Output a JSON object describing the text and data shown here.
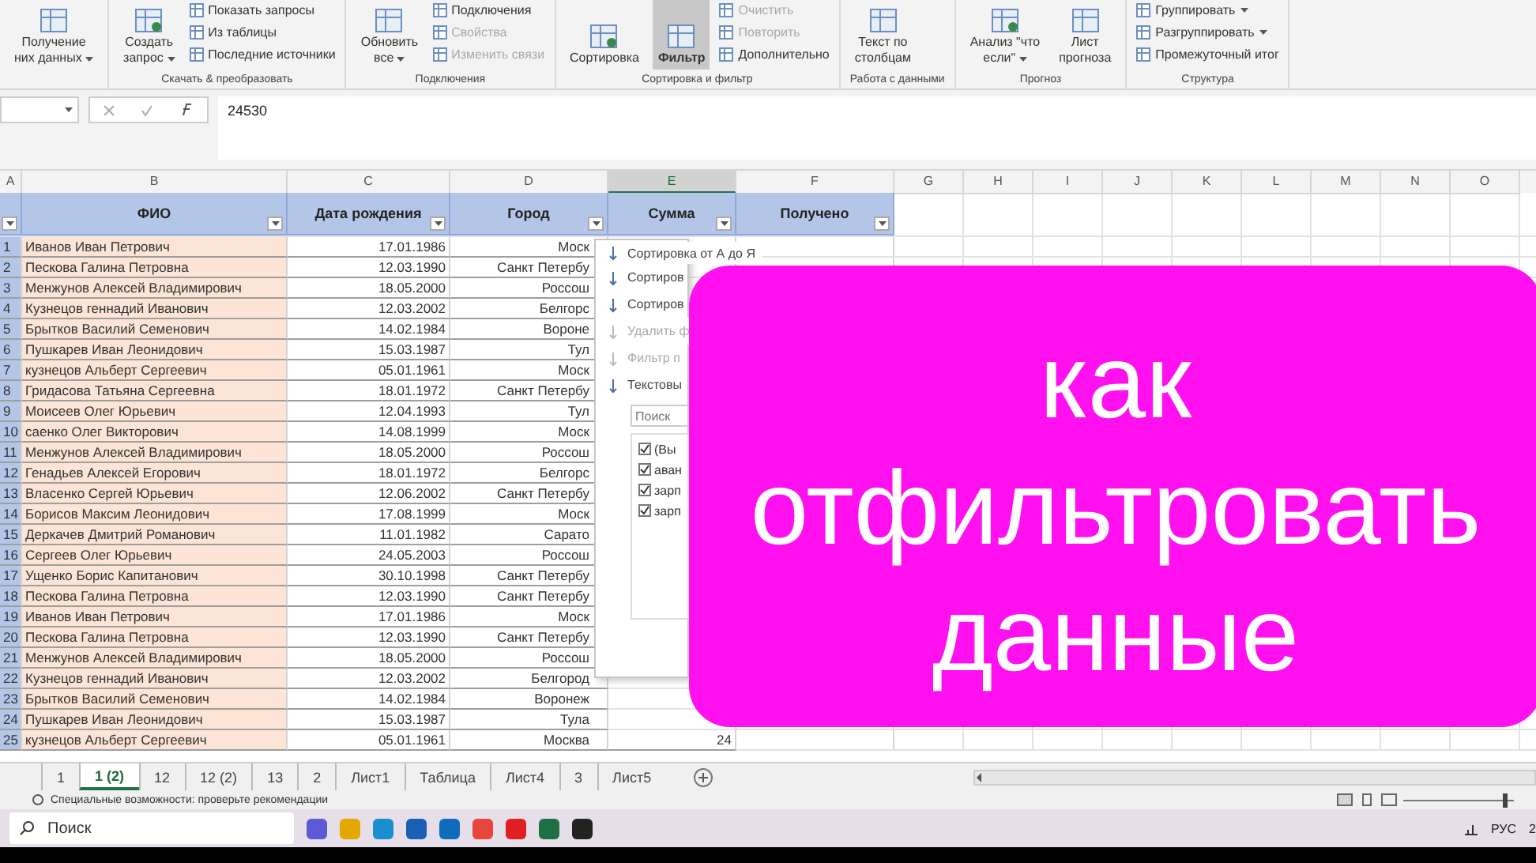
{
  "ribbon": {
    "groups": [
      {
        "items": [
          {
            "kind": "big",
            "lines": [
              "Получение",
              "них данных"
            ],
            "caret": true,
            "disabled": false,
            "selected": false
          }
        ]
      },
      {
        "label": "Скачать & преобразовать",
        "items": [
          {
            "kind": "big",
            "lines": [
              "Создать",
              "запрос"
            ],
            "caret": true,
            "disabled": false,
            "selected": false
          },
          {
            "kind": "small",
            "lines": [
              "Показать запросы"
            ],
            "caret": false,
            "disabled": false,
            "selected": false
          },
          {
            "kind": "small",
            "lines": [
              "Из таблицы"
            ],
            "caret": false,
            "disabled": false,
            "selected": false
          },
          {
            "kind": "small",
            "lines": [
              "Последние источники"
            ],
            "caret": false,
            "disabled": false,
            "selected": false
          }
        ]
      },
      {
        "label": "Подключения",
        "items": [
          {
            "kind": "big",
            "lines": [
              "Обновить",
              "все"
            ],
            "caret": true,
            "disabled": false,
            "selected": false
          },
          {
            "kind": "small",
            "lines": [
              "Подключения"
            ],
            "caret": false,
            "disabled": false,
            "selected": false
          },
          {
            "kind": "small",
            "lines": [
              "Свойства"
            ],
            "caret": false,
            "disabled": true,
            "selected": false
          },
          {
            "kind": "small",
            "lines": [
              "Изменить связи"
            ],
            "caret": false,
            "disabled": true,
            "selected": false
          }
        ]
      },
      {
        "label": "Сортировка и фильтр",
        "items": [
          {
            "kind": "big",
            "lines": [
              "Сортировка"
            ],
            "caret": false,
            "disabled": false,
            "selected": false
          },
          {
            "kind": "big",
            "lines": [
              "Фильтр"
            ],
            "caret": false,
            "disabled": false,
            "selected": true
          },
          {
            "kind": "small",
            "lines": [
              "Очистить"
            ],
            "caret": false,
            "disabled": true,
            "selected": false
          },
          {
            "kind": "small",
            "lines": [
              "Повторить"
            ],
            "caret": false,
            "disabled": true,
            "selected": false
          },
          {
            "kind": "small",
            "lines": [
              "Дополнительно"
            ],
            "caret": false,
            "disabled": false,
            "selected": false
          }
        ]
      },
      {
        "label": "Работа с данными",
        "items": [
          {
            "kind": "big",
            "lines": [
              "Текст по",
              "столбцам"
            ],
            "caret": false,
            "disabled": false,
            "selected": false
          }
        ]
      },
      {
        "label": "Прогноз",
        "items": [
          {
            "kind": "big",
            "lines": [
              "Анализ \"что",
              "если\""
            ],
            "caret": true,
            "disabled": false,
            "selected": false
          },
          {
            "kind": "big",
            "lines": [
              "Лист",
              "прогноза"
            ],
            "caret": false,
            "disabled": false,
            "selected": false
          }
        ]
      },
      {
        "label": "Структура",
        "items": [
          {
            "kind": "small",
            "lines": [
              "Группировать"
            ],
            "caret": true,
            "disabled": false,
            "selected": false
          },
          {
            "kind": "small",
            "lines": [
              "Разгруппировать"
            ],
            "caret": true,
            "disabled": false,
            "selected": false
          },
          {
            "kind": "small",
            "lines": [
              "Промежуточный итог"
            ],
            "caret": false,
            "disabled": false,
            "selected": false
          }
        ]
      }
    ]
  },
  "formula_bar": {
    "value": "24530"
  },
  "column_headers": [
    {
      "label": "A",
      "selected": false
    },
    {
      "label": "B",
      "selected": false
    },
    {
      "label": "C",
      "selected": false
    },
    {
      "label": "D",
      "selected": false
    },
    {
      "label": "E",
      "selected": true
    },
    {
      "label": "F",
      "selected": false
    },
    {
      "label": "G",
      "selected": false
    },
    {
      "label": "H",
      "selected": false
    },
    {
      "label": "I",
      "selected": false
    },
    {
      "label": "J",
      "selected": false
    },
    {
      "label": "K",
      "selected": false
    },
    {
      "label": "L",
      "selected": false
    },
    {
      "label": "M",
      "selected": false
    },
    {
      "label": "N",
      "selected": false
    },
    {
      "label": "O",
      "selected": false
    }
  ],
  "table": {
    "columns": [
      "",
      "ФИО",
      "Дата рождения",
      "Город",
      "Сумма",
      "Получено"
    ],
    "rows": [
      {
        "n": "1",
        "name": "Иванов Иван Петрович",
        "date": "17.01.1986",
        "city": "Моск",
        "sum": ""
      },
      {
        "n": "2",
        "name": "Пескова Галина Петровна",
        "date": "12.03.1990",
        "city": "Санкт Петербу",
        "sum": ""
      },
      {
        "n": "3",
        "name": "Менжунов Алексей Владимирович",
        "date": "18.05.2000",
        "city": "Россош",
        "sum": ""
      },
      {
        "n": "4",
        "name": "Кузнецов геннадий Иванович",
        "date": "12.03.2002",
        "city": "Белгорс",
        "sum": ""
      },
      {
        "n": "5",
        "name": "Брытков Василий Семенович",
        "date": "14.02.1984",
        "city": "Вороне",
        "sum": ""
      },
      {
        "n": "6",
        "name": "Пушкарев Иван Леонидович",
        "date": "15.03.1987",
        "city": "Тул",
        "sum": ""
      },
      {
        "n": "7",
        "name": "кузнецов Альберт Сергеевич",
        "date": "05.01.1961",
        "city": "Моск",
        "sum": ""
      },
      {
        "n": "8",
        "name": "Гридасова Татьяна Сергеевна",
        "date": "18.01.1972",
        "city": "Санкт Петербу",
        "sum": ""
      },
      {
        "n": "9",
        "name": "Моисеев Олег Юрьевич",
        "date": "12.04.1993",
        "city": "Тул",
        "sum": ""
      },
      {
        "n": "10",
        "name": "саенко Олег Викторович",
        "date": "14.08.1999",
        "city": "Моск",
        "sum": ""
      },
      {
        "n": "11",
        "name": "Менжунов Алексей Владимирович",
        "date": "18.05.2000",
        "city": "Россош",
        "sum": ""
      },
      {
        "n": "12",
        "name": "Генадьев Алексей Егорович",
        "date": "18.01.1972",
        "city": "Белгорс",
        "sum": ""
      },
      {
        "n": "13",
        "name": "Власенко Сергей Юрьевич",
        "date": "12.06.2002",
        "city": "Санкт Петербу",
        "sum": ""
      },
      {
        "n": "14",
        "name": "Борисов Максим Леонидович",
        "date": "17.08.1999",
        "city": "Моск",
        "sum": ""
      },
      {
        "n": "15",
        "name": "Деркачев Дмитрий Романович",
        "date": "11.01.1982",
        "city": "Сарато",
        "sum": ""
      },
      {
        "n": "16",
        "name": "Сергеев Олег Юрьевич",
        "date": "24.05.2003",
        "city": "Россош",
        "sum": ""
      },
      {
        "n": "17",
        "name": "Ущенко Борис Капитанович",
        "date": "30.10.1998",
        "city": "Санкт Петербу",
        "sum": ""
      },
      {
        "n": "18",
        "name": "Пескова Галина Петровна",
        "date": "12.03.1990",
        "city": "Санкт Петербу",
        "sum": ""
      },
      {
        "n": "19",
        "name": "Иванов Иван Петрович",
        "date": "17.01.1986",
        "city": "Моск",
        "sum": ""
      },
      {
        "n": "20",
        "name": "Пескова Галина Петровна",
        "date": "12.03.1990",
        "city": "Санкт Петербу",
        "sum": ""
      },
      {
        "n": "21",
        "name": "Менжунов Алексей Владимирович",
        "date": "18.05.2000",
        "city": "Россош",
        "sum": ""
      },
      {
        "n": "22",
        "name": "Кузнецов геннадий Иванович",
        "date": "12.03.2002",
        "city": "Белгород",
        "sum": ""
      },
      {
        "n": "23",
        "name": "Брытков Василий Семенович",
        "date": "14.02.1984",
        "city": "Воронеж",
        "sum": ""
      },
      {
        "n": "24",
        "name": "Пушкарев Иван Леонидович",
        "date": "15.03.1987",
        "city": "Тула",
        "sum": ""
      },
      {
        "n": "25",
        "name": "кузнецов Альберт Сергеевич",
        "date": "05.01.1961",
        "city": "Москва",
        "sum": "24"
      }
    ]
  },
  "filter_menu": {
    "items": [
      {
        "label": "Сортировка от А до Я",
        "disabled": false
      },
      {
        "label": "Сортиров",
        "disabled": false
      },
      {
        "label": "Сортиров",
        "disabled": false
      },
      {
        "label": "Удалить ф",
        "disabled": true
      },
      {
        "label": "Фильтр п",
        "disabled": true
      },
      {
        "label": "Текстовы",
        "disabled": false
      }
    ],
    "search": {
      "placeholder": "Поиск"
    },
    "values": [
      {
        "label": "(Вы",
        "checked": true
      },
      {
        "label": "аван",
        "checked": true
      },
      {
        "label": "зарп",
        "checked": true
      },
      {
        "label": "зарп",
        "checked": true
      }
    ]
  },
  "banner": {
    "title": "как отфильтровать данные"
  },
  "sheet_tabs": [
    {
      "label": "1",
      "selected": false
    },
    {
      "label": "1 (2)",
      "selected": true
    },
    {
      "label": "12",
      "selected": false
    },
    {
      "label": "12 (2)",
      "selected": false
    },
    {
      "label": "13",
      "selected": false
    },
    {
      "label": "2",
      "selected": false
    },
    {
      "label": "Лист1",
      "selected": false
    },
    {
      "label": "Таблица",
      "selected": false
    },
    {
      "label": "Лист4",
      "selected": false
    },
    {
      "label": "3",
      "selected": false
    },
    {
      "label": "Лист5",
      "selected": false
    }
  ],
  "status_bar": {
    "text": "Специальные возможности: проверьте рекомендации",
    "zoom_slider": {
      "level": 0.9
    }
  },
  "taskbar": {
    "search_placeholder": "Поиск",
    "language": "РУС",
    "clock": "2"
  }
}
